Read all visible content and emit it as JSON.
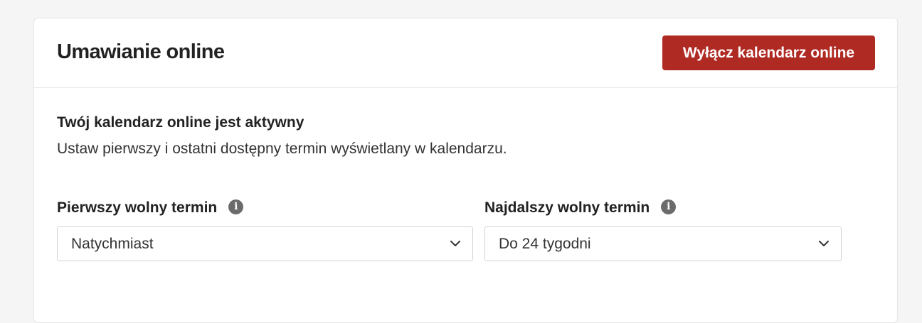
{
  "header": {
    "title": "Umawianie online",
    "disable_button_label": "Wyłącz kalendarz online"
  },
  "status": {
    "heading": "Twój kalendarz online jest aktywny",
    "description": "Ustaw pierwszy i ostatni dostępny termin wyświetlany w kalendarzu."
  },
  "fields": {
    "first": {
      "label": "Pierwszy wolny termin",
      "value": "Natychmiast",
      "icon": "info-icon"
    },
    "last": {
      "label": "Najdalszy wolny termin",
      "value": "Do 24 tygodni",
      "icon": "info-icon"
    }
  },
  "colors": {
    "accent_button": "#b02a24",
    "info_icon": "#6b6b6b"
  }
}
